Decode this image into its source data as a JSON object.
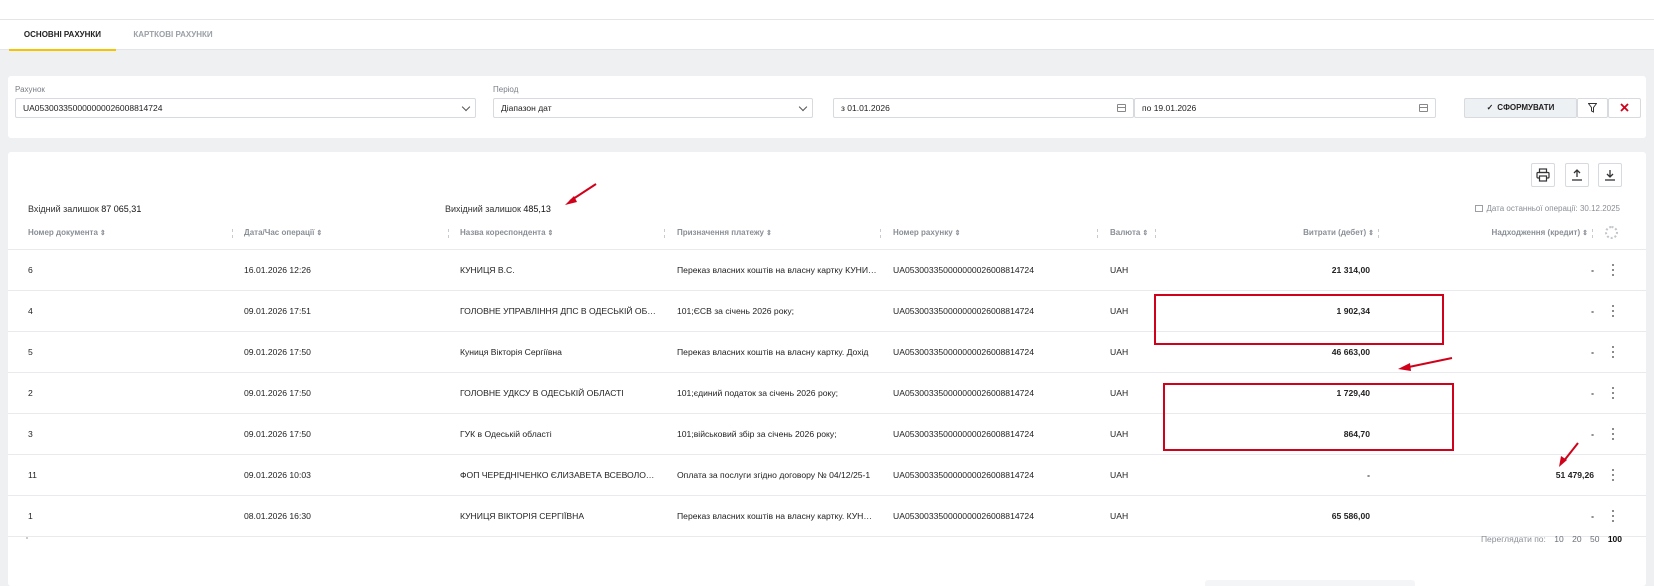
{
  "tabs": [
    {
      "label": "ОСНОВНІ РАХУНКИ",
      "active": true
    },
    {
      "label": "КАРТКОВІ РАХУНКИ",
      "active": false
    }
  ],
  "filters": {
    "account_label": "Рахунок",
    "account_value": "UA053003350000000026008814724",
    "period_label": "Період",
    "period_value": "Діапазон дат",
    "date_from": "з 01.01.2026",
    "date_to": "по 19.01.2026",
    "submit_label": "СФОРМУВАТИ"
  },
  "summary": {
    "opening_label": "Вхідний залишок",
    "opening_value": "87 065,31",
    "closing_label": "Вихідний залишок",
    "closing_value": "485,13",
    "last_operation": "Дата останньої операції: 30.12.2025"
  },
  "table": {
    "columns": [
      "Номер документа",
      "Дата/Час операції",
      "Назва кореспондента",
      "Призначення платежу",
      "Номер рахунку",
      "Валюта",
      "Витрати (дебет)",
      "Надходження (кредит)"
    ],
    "rows": [
      {
        "doc": "6",
        "date": "16.01.2026 12:26",
        "name": "КУНИЦЯ В.С.",
        "purpose": "Переказ власних коштів на власну картку КУНИЦЯ В.С.",
        "account": "UA053003350000000026008814724",
        "currency": "UAH",
        "debit": "21 314,00",
        "credit": "-"
      },
      {
        "doc": "4",
        "date": "09.01.2026 17:51",
        "name": "ГОЛОВНЕ УПРАВЛІННЯ ДПС В ОДЕСЬКІЙ ОБЛАСТІ",
        "purpose": "101;ЄСВ за січень 2026 року;",
        "account": "UA053003350000000026008814724",
        "currency": "UAH",
        "debit": "1 902,34",
        "credit": "-"
      },
      {
        "doc": "5",
        "date": "09.01.2026 17:50",
        "name": "Куниця Вікторія Сергіївна",
        "purpose": "Переказ власних коштів на власну картку. Дохід",
        "account": "UA053003350000000026008814724",
        "currency": "UAH",
        "debit": "46 663,00",
        "credit": "-"
      },
      {
        "doc": "2",
        "date": "09.01.2026 17:50",
        "name": "ГОЛОВНЕ УДКСУ В ОДЕСЬКІЙ ОБЛАСТІ",
        "purpose": "101;єдиний податок за січень 2026 року;",
        "account": "UA053003350000000026008814724",
        "currency": "UAH",
        "debit": "1 729,40",
        "credit": "-"
      },
      {
        "doc": "3",
        "date": "09.01.2026 17:50",
        "name": "ГУК в Одеській області",
        "purpose": "101;військовий збір за січень 2026 року;",
        "account": "UA053003350000000026008814724",
        "currency": "UAH",
        "debit": "864,70",
        "credit": "-"
      },
      {
        "doc": "11",
        "date": "09.01.2026 10:03",
        "name": "ФОП ЧЕРЕДНІЧЕНКО ЄЛИЗАВЕТА ВСЕВОЛОДІВНА",
        "purpose": "Оплата за послуги згідно договору № 04/12/25-1",
        "account": "UA053003350000000026008814724",
        "currency": "UAH",
        "debit": "-",
        "credit": "51 479,26"
      },
      {
        "doc": "1",
        "date": "08.01.2026 16:30",
        "name": "КУНИЦЯ ВІКТОРІЯ СЕРГІЇВНА",
        "purpose": "Переказ власних коштів на власну картку. КУНИЦЯ",
        "account": "UA053003350000000026008814724",
        "currency": "UAH",
        "debit": "65 586,00",
        "credit": "-"
      }
    ]
  },
  "pagination": {
    "label": "Переглядати по:",
    "options": [
      "10",
      "20",
      "50",
      "100"
    ],
    "selected": "100"
  },
  "colors": {
    "accent": "#f5c400",
    "annotation": "#d0021b"
  }
}
